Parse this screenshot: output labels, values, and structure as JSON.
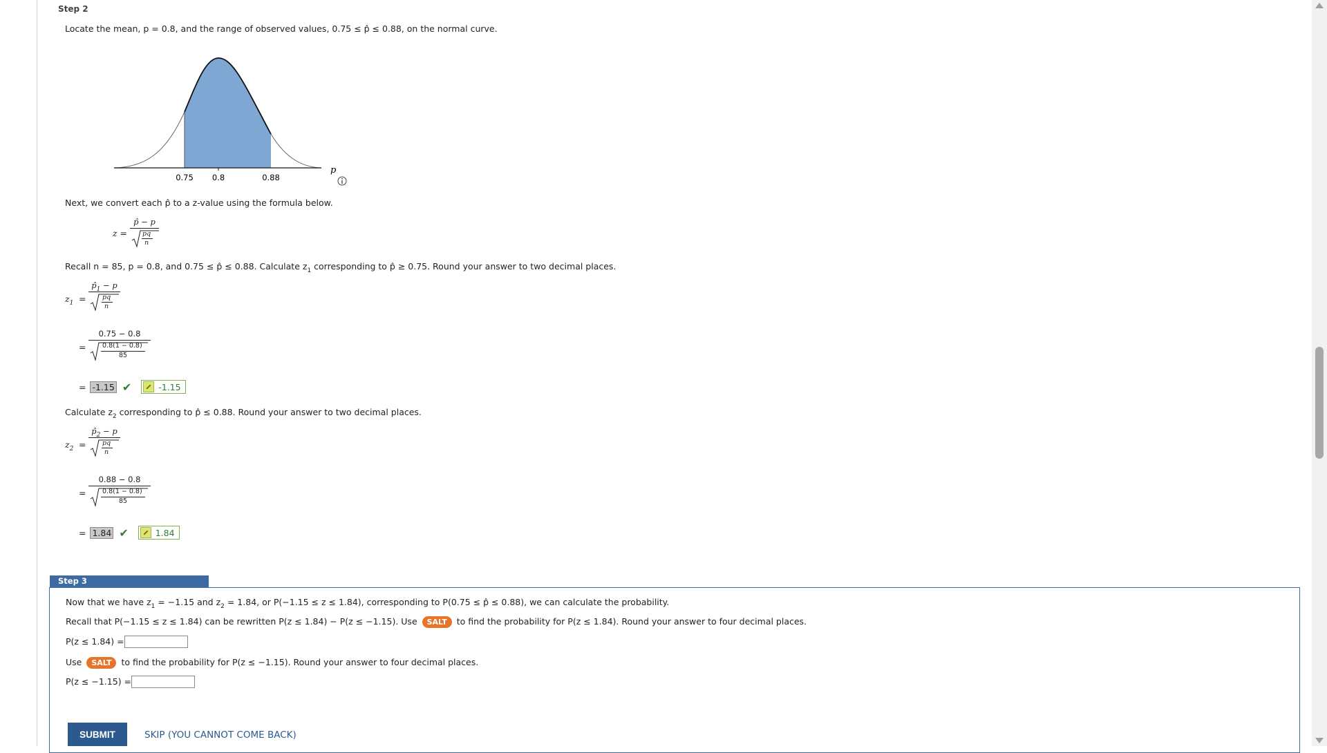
{
  "step2": {
    "heading": "Step 2",
    "locate_text": "Locate the mean, p = 0.8, and the range of observed values, 0.75 ≤ p̂ ≤ 0.88, on the normal curve.",
    "chart": {
      "axis_label": "p",
      "tick_labels": [
        "0.75",
        "0.8",
        "0.88"
      ],
      "info_icon": "info-icon"
    },
    "next_text": "Next, we convert each p̂ to a z-value using the formula below.",
    "formula": {
      "lhs": "z =",
      "numerator": "p̂ − p",
      "denom_num": "pq",
      "denom_den": "n"
    },
    "recall_text_a": "Recall n = 85, p = 0.8, and 0.75 ≤ p̂ ≤ 0.88. Calculate z",
    "recall_sub": "1",
    "recall_text_b": " corresponding to p̂ ≥ 0.75. Round your answer to two decimal places.",
    "z1": {
      "lhs": "z",
      "lhs_sub": "1",
      "eq": "=",
      "num_a": "p̂",
      "num_sub": "1",
      "num_b": " − p",
      "den_num": "pq",
      "den_den": "n",
      "sub_num": "0.75 − 0.8",
      "sub_den_num": "0.8(1 − 0.8)",
      "sub_den_den": "85",
      "answer": "-1.15",
      "key_answer": "-1.15"
    },
    "calc2_text_a": "Calculate z",
    "calc2_sub": "2",
    "calc2_text_b": " corresponding to p̂ ≤ 0.88. Round your answer to two decimal places.",
    "z2": {
      "lhs": "z",
      "lhs_sub": "2",
      "eq": "=",
      "num_a": "p̂",
      "num_sub": "2",
      "num_b": " − p",
      "den_num": "pq",
      "den_den": "n",
      "sub_num": "0.88 − 0.8",
      "sub_den_num": "0.8(1 − 0.8)",
      "sub_den_den": "85",
      "answer": "1.84",
      "key_answer": "1.84"
    }
  },
  "step3": {
    "heading": "Step 3",
    "now_a": "Now that we have z",
    "now_sub1": "1",
    "now_b": " = −1.15 and z",
    "now_sub2": "2",
    "now_c": " = 1.84, or P(−1.15 ≤ z ≤ 1.84), corresponding to P(0.75 ≤ p̂ ≤ 0.88), we can calculate the probability.",
    "recall_a": "Recall that P(−1.15 ≤ z ≤ 1.84) can be rewritten P(z ≤ 1.84) − P(z ≤ −1.15). Use",
    "salt_label": "SALT",
    "recall_b": "to find the probability for P(z ≤ 1.84). Round your answer to four decimal places.",
    "p1_label": "P(z ≤ 1.84) =",
    "p1_value": "",
    "use_a": "Use",
    "use_b": "to find the probability for P(z ≤ −1.15). Round your answer to four decimal places.",
    "p2_label": "P(z ≤ −1.15) =",
    "p2_value": ""
  },
  "actions": {
    "submit_label": "SUBMIT",
    "skip_label": "SKIP (YOU CANNOT COME BACK)"
  },
  "colors": {
    "accent": "#3d6aa3",
    "salt": "#e8742a",
    "shade": "#7ea7d4",
    "correct": "#2e7d32"
  }
}
